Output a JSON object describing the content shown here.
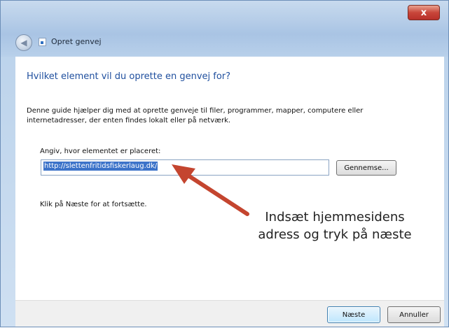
{
  "window": {
    "title": "Opret genvej",
    "close_label": "x"
  },
  "wizard": {
    "heading": "Hvilket element vil du oprette en genvej for?",
    "description": "Denne guide hjælper dig med at oprette genveje til filer, programmer, mapper, computere eller internetadresser, der enten findes lokalt eller på netværk.",
    "location_label": "Angiv, hvor elementet er placeret:",
    "location_value": "http://slettenfritidsfiskerlaug.dk/",
    "browse_label": "Gennemse...",
    "hint": "Klik på Næste for at fortsætte."
  },
  "annotation": {
    "line1": "Indsæt hjemmesidens",
    "line2": "adress og tryk på næste"
  },
  "buttons": {
    "next_label": "Næste",
    "cancel_label": "Annuller"
  },
  "icons": {
    "back": "back-arrow-icon",
    "shortcut": "shortcut-icon",
    "close": "close-icon"
  },
  "colors": {
    "heading": "#1f4f9e",
    "selection": "#3c73c9",
    "arrow": "#c4452f"
  }
}
